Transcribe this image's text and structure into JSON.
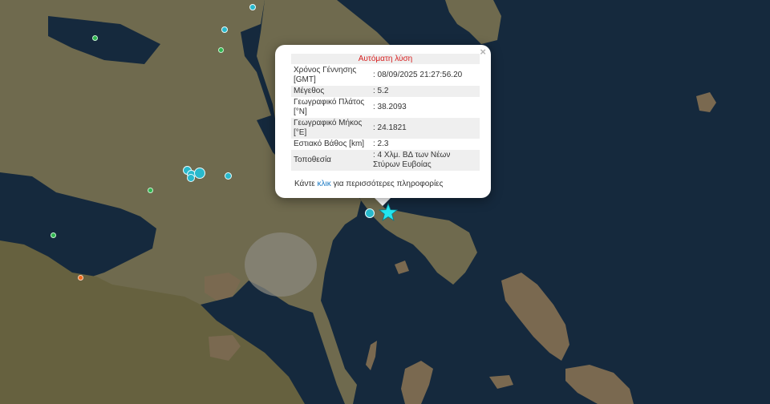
{
  "popup": {
    "title": "Αυτόματη λύση",
    "close_label": "×",
    "rows": [
      {
        "label": "Χρόνος Γέννησης [GMT]",
        "value": ": 08/09/2025 21:27:56.20"
      },
      {
        "label": "Μέγεθος",
        "value": ": 5.2"
      },
      {
        "label": "Γεωγραφικό Πλάτος [°N]",
        "value": ": 38.2093"
      },
      {
        "label": "Γεωγραφικό Μήκος [°E]",
        "value": ": 24.1821"
      },
      {
        "label": "Εστιακό Βάθος [km]",
        "value": ": 2.3"
      },
      {
        "label": "Τοποθεσία",
        "value": ": 4 Χλμ. ΒΔ των Νέων Στύρων Ευβοίας"
      }
    ],
    "footer_prefix": "Κάντε ",
    "footer_link": "κλικ",
    "footer_suffix": " για περισσότερες πληροφορίες"
  },
  "colors": {
    "sea": "#14283c",
    "land": "#6b6b4e",
    "marker_cyan": "#28b9cc",
    "marker_green": "#2fb54f",
    "marker_orange": "#ef6a1c",
    "popup_title": "#d81f1f",
    "link": "#1a7ac4"
  },
  "icons": {
    "epicenter": "star-icon",
    "close": "close-icon"
  }
}
